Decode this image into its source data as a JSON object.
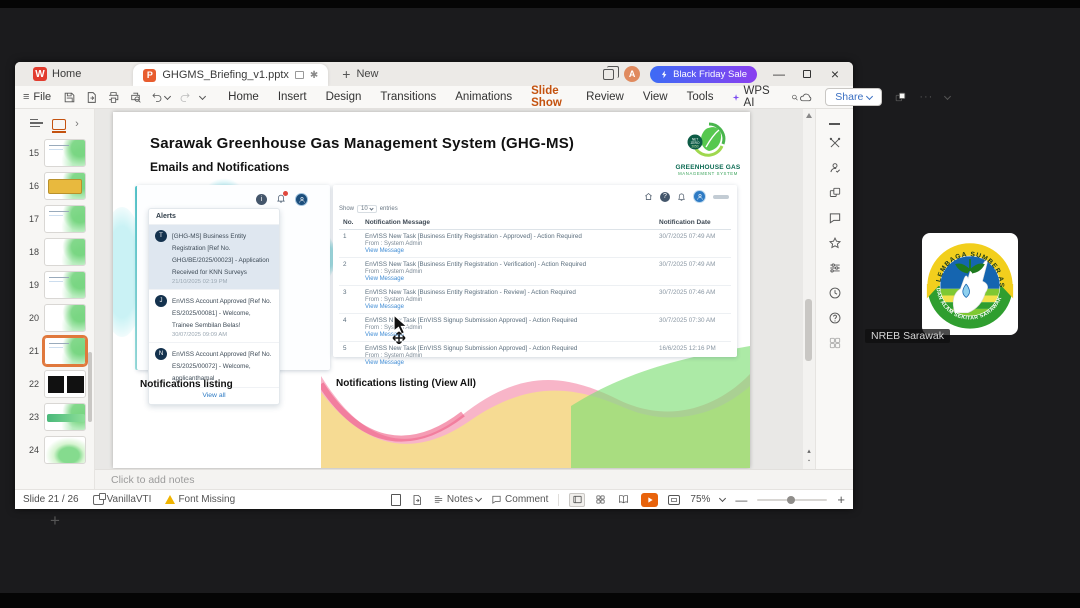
{
  "window": {
    "tab_home": "Home",
    "tab_document": "GHGMS_Briefing_v1.pptx",
    "tab_new": "New",
    "promo_label": "Black Friday Sale",
    "avatar_letter": "A",
    "minimize_glyph": "—",
    "close_glyph": "×"
  },
  "ribbon": {
    "file_label": "File",
    "menus": [
      "Home",
      "Insert",
      "Design",
      "Transitions",
      "Animations",
      "Slide Show",
      "Review",
      "View",
      "Tools",
      "WPS AI"
    ],
    "active_menu": "Slide Show",
    "share_label": "Share",
    "more_glyph": "···"
  },
  "slide_panel": {
    "numbers": [
      "15",
      "16",
      "17",
      "18",
      "19",
      "20",
      "21",
      "22",
      "23",
      "24"
    ],
    "selected": "21",
    "add_glyph": "+"
  },
  "slide": {
    "title": "Sarawak Greenhouse Gas Management System (GHG-MS)",
    "subtitle": "Emails and Notifications",
    "caption_left": "Notifications listing",
    "caption_right": "Notifications listing (View All)",
    "logo": {
      "badge": "NET ZERO 2050",
      "name_line1": "GREENHOUSE GAS",
      "name_line2": "MANAGEMENT SYSTEM"
    },
    "alerts": {
      "title": "Alerts",
      "items": [
        {
          "avatar": "T",
          "text": "[GHG-MS] Business Entity Registration [Ref No. GHG/BE/2025/00023] - Application Received for KNN Surveys",
          "date": "21/10/2025 02:19 PM"
        },
        {
          "avatar": "J",
          "text": "EnVISS Account Approved [Ref No. ES/2025/00081] - Welcome, Trainee Sembilan Belas!",
          "date": "30/07/2025 09:09 AM"
        },
        {
          "avatar": "N",
          "text": "EnVISS Account Approved [Ref No. ES/2025/00072] - Welcome, applicanthamal",
          "date": ""
        }
      ],
      "view_all": "View all"
    },
    "notif_table": {
      "show_label": "Show",
      "page_size": "10",
      "entries_label": "entries",
      "col_no": "No.",
      "col_message": "Notification Message",
      "col_date": "Notification Date",
      "rows": [
        {
          "no": "1",
          "message": "EnVISS New Task [Business Entity Registration - Approved] - Action Required",
          "from": "From : System Admin",
          "link": "View Message",
          "date": "30/7/2025 07:49 AM"
        },
        {
          "no": "2",
          "message": "EnVISS New Task [Business Entity Registration - Verification] - Action Required",
          "from": "From : System Admin",
          "link": "View Message",
          "date": "30/7/2025 07:49 AM"
        },
        {
          "no": "3",
          "message": "EnVISS New Task [Business Entity Registration - Review] - Action Required",
          "from": "From : System Admin",
          "link": "View Message",
          "date": "30/7/2025 07:46 AM"
        },
        {
          "no": "4",
          "message": "EnVISS New Task [EnVISS Signup Submission Approved] - Action Required",
          "from": "From : System Admin",
          "link": "View Message",
          "date": "30/7/2025 07:30 AM"
        },
        {
          "no": "5",
          "message": "EnVISS New Task [EnVISS Signup Submission Approved] - Action Required",
          "from": "From : System Admin",
          "link": "View Message",
          "date": "16/6/2025 12:16 PM"
        }
      ]
    }
  },
  "notes_placeholder": "Click to add notes",
  "status": {
    "slide_indicator": "Slide 21 / 26",
    "theme_name": "VanillaVTI",
    "font_warning": "Font Missing",
    "notes_label": "Notes",
    "comment_label": "Comment",
    "zoom_level": "75%"
  },
  "participant": {
    "name": "NREB Sarawak",
    "logo_text_top": "LEMBAGA SUMBER ASLI",
    "logo_text_bottom": "DAN ALAM SEKITAR SARAWAK"
  },
  "colors": {
    "accent_orange": "#c4520f",
    "promo_gradient_start": "#3d6bf5",
    "promo_gradient_end": "#8a3ff0",
    "selected_thumb_border": "#e0783c",
    "link_blue": "#3f8cd5",
    "play_button_orange": "#e8630c",
    "warning_yellow": "#f0b400",
    "logo_green": "#2f9e2f",
    "logo_yellow": "#f2cf1d",
    "teal_accent": "#59cdd1"
  }
}
